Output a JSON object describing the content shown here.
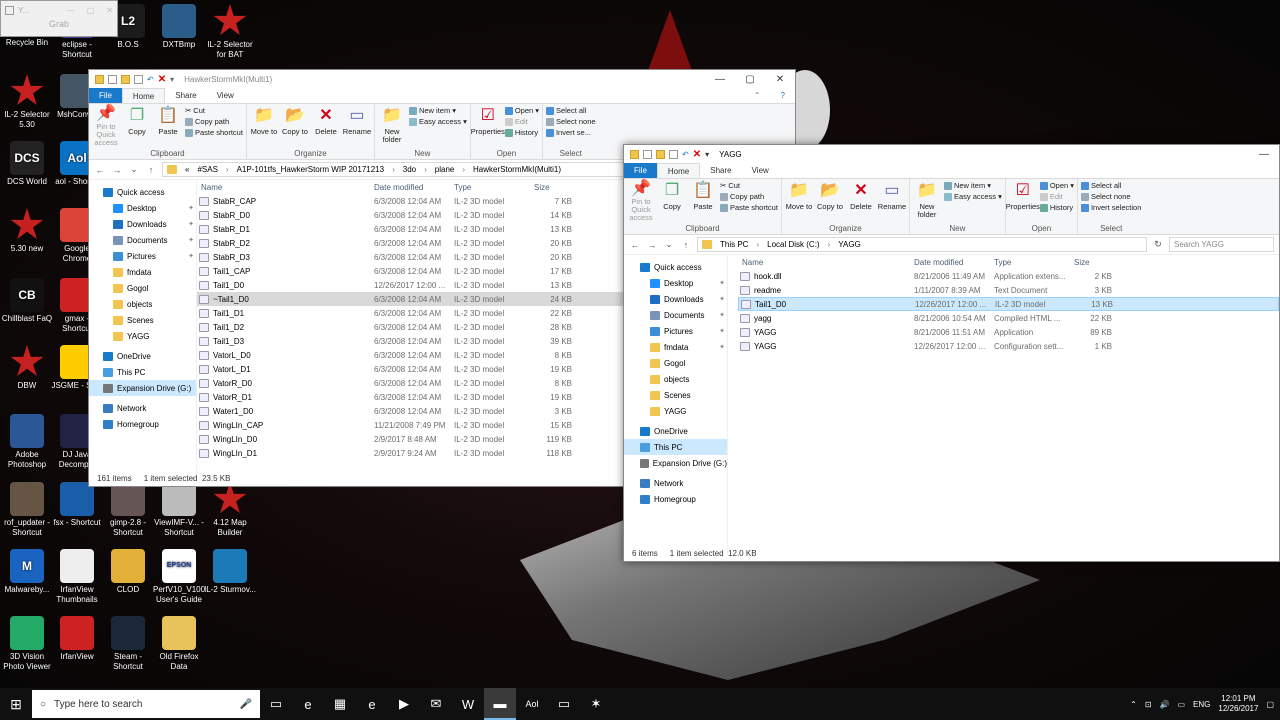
{
  "desktop": {
    "grab_window": {
      "title": "Y...",
      "label": "Grab"
    },
    "icons": [
      {
        "label": "Recycle Bin",
        "icon": "recycle-bin-icon"
      },
      {
        "label": "eclipse - Shortcut",
        "icon": "eclipse-icon"
      },
      {
        "label": "B.O.S",
        "icon": "bos-icon",
        "glyph": "L2"
      },
      {
        "label": "DXTBmp",
        "icon": "plane-icon"
      },
      {
        "label": "IL-2 Selector for BAT",
        "icon": "il2-star-icon"
      },
      {
        "label": "IL-2 Selector 5.30",
        "icon": "il2-star-icon"
      },
      {
        "label": "MshConv...",
        "icon": "document-icon"
      },
      {
        "label": "DCS World",
        "icon": "dcs-icon",
        "glyph": "DCS"
      },
      {
        "label": "aol - Short...",
        "icon": "aol-icon",
        "glyph": "Aol"
      },
      {
        "label": "5.30 new",
        "icon": "il2-star-icon"
      },
      {
        "label": "Google Chrome",
        "icon": "chrome-icon"
      },
      {
        "label": "Chillblast FaQ",
        "icon": "chillblast-icon",
        "glyph": "CB"
      },
      {
        "label": "gmax - Shortcut",
        "icon": "gmax-icon"
      },
      {
        "label": "DBW",
        "icon": "il2-star-icon"
      },
      {
        "label": "JSGME - Sh...",
        "icon": "jsgme-icon"
      },
      {
        "label": "Adobe Photoshop",
        "icon": "photoshop-icon"
      },
      {
        "label": "DJ Java Decomp...",
        "icon": "java-icon"
      },
      {
        "label": "rof_updater - Shortcut",
        "icon": "rof-icon"
      },
      {
        "label": "fsx - Shortcut",
        "icon": "fsx-icon"
      },
      {
        "label": "gimp-2.8 - Shortcut",
        "icon": "gimp-icon"
      },
      {
        "label": "ViewIMF-V... - Shortcut",
        "icon": "document-icon"
      },
      {
        "label": "4.12 Map Builder",
        "icon": "il2-star-icon"
      },
      {
        "label": "Malwareby...",
        "icon": "malwarebytes-icon",
        "glyph": "M"
      },
      {
        "label": "IrfanView Thumbnails",
        "icon": "irfanview-icon"
      },
      {
        "label": "CLOD",
        "icon": "clod-icon"
      },
      {
        "label": "PerfV10_V100 User's Guide",
        "icon": "epson-icon",
        "glyph": "EPSON"
      },
      {
        "label": "IL-2 Sturmov...",
        "icon": "il2-sturmovik-icon"
      },
      {
        "label": "3D Vision Photo Viewer",
        "icon": "3d-vision-icon"
      },
      {
        "label": "IrfanView",
        "icon": "irfanview-icon"
      },
      {
        "label": "Steam - Shortcut",
        "icon": "steam-icon"
      },
      {
        "label": "Old Firefox Data",
        "icon": "folder-icon"
      }
    ]
  },
  "ribbon": {
    "tabs": [
      "File",
      "Home",
      "Share",
      "View"
    ],
    "clipboard": {
      "pin": "Pin to Quick access",
      "copy": "Copy",
      "paste": "Paste",
      "cut": "Cut",
      "copy_path": "Copy path",
      "paste_shortcut": "Paste shortcut",
      "name": "Clipboard"
    },
    "organize": {
      "move_to": "Move to",
      "copy_to": "Copy to",
      "delete": "Delete",
      "rename": "Rename",
      "name": "Organize"
    },
    "new": {
      "new_folder": "New folder",
      "new_item": "New item",
      "easy_access": "Easy access",
      "name": "New"
    },
    "open": {
      "properties": "Properties",
      "open": "Open",
      "edit": "Edit",
      "history": "History",
      "name": "Open"
    },
    "select": {
      "select_all": "Select all",
      "select_none": "Select none",
      "invert": "Invert selection",
      "name": "Select"
    }
  },
  "left_window": {
    "title": "HawkerStormMkI(Multi1)",
    "ribbon_truncated": {
      "invert": "Invert se...",
      "select_name": "Select"
    },
    "path": [
      "«",
      "#SAS",
      "A1P-101tfs_HawkerStorm WIP 20171213",
      "3do",
      "plane",
      "HawkerStormMkI(Multi1)"
    ],
    "nav": [
      {
        "label": "Quick access",
        "icon": "star-icon",
        "color": "#1979ca",
        "pin": false
      },
      {
        "label": "Desktop",
        "icon": "desktop-icon",
        "color": "#1e90ff",
        "pin": true
      },
      {
        "label": "Downloads",
        "icon": "downloads-icon",
        "color": "#1e6fc2",
        "pin": true
      },
      {
        "label": "Documents",
        "icon": "documents-icon",
        "color": "#7a94b8",
        "pin": true
      },
      {
        "label": "Pictures",
        "icon": "pictures-icon",
        "color": "#3b8ed8",
        "pin": true
      },
      {
        "label": "fmdata",
        "icon": "folder-icon",
        "color": "#f1c550",
        "pin": false
      },
      {
        "label": "Gogol",
        "icon": "folder-icon",
        "color": "#f1c550",
        "pin": false
      },
      {
        "label": "objects",
        "icon": "folder-icon",
        "color": "#f1c550",
        "pin": false
      },
      {
        "label": "Scenes",
        "icon": "folder-icon",
        "color": "#f1c550",
        "pin": false
      },
      {
        "label": "YAGG",
        "icon": "folder-icon",
        "color": "#f1c550",
        "pin": false
      },
      {
        "label": "OneDrive",
        "icon": "onedrive-icon",
        "color": "#1979ca",
        "pin": false
      },
      {
        "label": "This PC",
        "icon": "pc-icon",
        "color": "#4a9ee0",
        "pin": false
      },
      {
        "label": "Expansion Drive (G:)",
        "icon": "drive-icon",
        "color": "#777777",
        "pin": false,
        "selected": true
      },
      {
        "label": "Network",
        "icon": "network-icon",
        "color": "#3b7bc2",
        "pin": false
      },
      {
        "label": "Homegroup",
        "icon": "homegroup-icon",
        "color": "#2f7fc8",
        "pin": false
      }
    ],
    "columns": [
      "Name",
      "Date modified",
      "Type",
      "Size"
    ],
    "files": [
      {
        "name": "StabR_CAP",
        "date": "6/3/2008 12:04 AM",
        "type": "IL-2 3D model",
        "size": "7 KB"
      },
      {
        "name": "StabR_D0",
        "date": "6/3/2008 12:04 AM",
        "type": "IL-2 3D model",
        "size": "14 KB"
      },
      {
        "name": "StabR_D1",
        "date": "6/3/2008 12:04 AM",
        "type": "IL-2 3D model",
        "size": "13 KB"
      },
      {
        "name": "StabR_D2",
        "date": "6/3/2008 12:04 AM",
        "type": "IL-2 3D model",
        "size": "20 KB"
      },
      {
        "name": "StabR_D3",
        "date": "6/3/2008 12:04 AM",
        "type": "IL-2 3D model",
        "size": "20 KB"
      },
      {
        "name": "Tail1_CAP",
        "date": "6/3/2008 12:04 AM",
        "type": "IL-2 3D model",
        "size": "17 KB"
      },
      {
        "name": "Tail1_D0",
        "date": "12/26/2017 12:00 ...",
        "type": "IL-2 3D model",
        "size": "13 KB"
      },
      {
        "name": "~Tail1_D0",
        "date": "6/3/2008 12:04 AM",
        "type": "IL-2 3D model",
        "size": "24 KB",
        "highlight": true
      },
      {
        "name": "Tail1_D1",
        "date": "6/3/2008 12:04 AM",
        "type": "IL-2 3D model",
        "size": "22 KB"
      },
      {
        "name": "Tail1_D2",
        "date": "6/3/2008 12:04 AM",
        "type": "IL-2 3D model",
        "size": "28 KB"
      },
      {
        "name": "Tail1_D3",
        "date": "6/3/2008 12:04 AM",
        "type": "IL-2 3D model",
        "size": "39 KB"
      },
      {
        "name": "VatorL_D0",
        "date": "6/3/2008 12:04 AM",
        "type": "IL-2 3D model",
        "size": "8 KB"
      },
      {
        "name": "VatorL_D1",
        "date": "6/3/2008 12:04 AM",
        "type": "IL-2 3D model",
        "size": "19 KB"
      },
      {
        "name": "VatorR_D0",
        "date": "6/3/2008 12:04 AM",
        "type": "IL-2 3D model",
        "size": "8 KB"
      },
      {
        "name": "VatorR_D1",
        "date": "6/3/2008 12:04 AM",
        "type": "IL-2 3D model",
        "size": "19 KB"
      },
      {
        "name": "Water1_D0",
        "date": "6/3/2008 12:04 AM",
        "type": "IL-2 3D model",
        "size": "3 KB"
      },
      {
        "name": "WingLIn_CAP",
        "date": "11/21/2008 7:49 PM",
        "type": "IL-2 3D model",
        "size": "15 KB"
      },
      {
        "name": "WingLIn_D0",
        "date": "2/9/2017 8:48 AM",
        "type": "IL-2 3D model",
        "size": "119 KB"
      },
      {
        "name": "WingLIn_D1",
        "date": "2/9/2017 9:24 AM",
        "type": "IL-2 3D model",
        "size": "118 KB"
      }
    ],
    "status": {
      "items": "161 items",
      "selected": "1 item selected",
      "size": "23.5 KB"
    }
  },
  "right_window": {
    "title": "YAGG",
    "path": [
      "This PC",
      "Local Disk (C:)",
      "YAGG"
    ],
    "search_placeholder": "Search YAGG",
    "nav": [
      {
        "label": "Quick access",
        "icon": "star-icon",
        "color": "#1979ca",
        "pin": false
      },
      {
        "label": "Desktop",
        "icon": "desktop-icon",
        "color": "#1e90ff",
        "pin": true
      },
      {
        "label": "Downloads",
        "icon": "downloads-icon",
        "color": "#1e6fc2",
        "pin": true
      },
      {
        "label": "Documents",
        "icon": "documents-icon",
        "color": "#7a94b8",
        "pin": true
      },
      {
        "label": "Pictures",
        "icon": "pictures-icon",
        "color": "#3b8ed8",
        "pin": true
      },
      {
        "label": "fmdata",
        "icon": "folder-icon",
        "color": "#f1c550",
        "pin": true
      },
      {
        "label": "Gogol",
        "icon": "folder-icon",
        "color": "#f1c550",
        "pin": false
      },
      {
        "label": "objects",
        "icon": "folder-icon",
        "color": "#f1c550",
        "pin": false
      },
      {
        "label": "Scenes",
        "icon": "folder-icon",
        "color": "#f1c550",
        "pin": false
      },
      {
        "label": "YAGG",
        "icon": "folder-icon",
        "color": "#f1c550",
        "pin": false
      },
      {
        "label": "OneDrive",
        "icon": "onedrive-icon",
        "color": "#1979ca",
        "pin": false
      },
      {
        "label": "This PC",
        "icon": "pc-icon",
        "color": "#4a9ee0",
        "pin": false,
        "selected": true
      },
      {
        "label": "Expansion Drive (G:)",
        "icon": "drive-icon",
        "color": "#777777",
        "pin": false
      },
      {
        "label": "Network",
        "icon": "network-icon",
        "color": "#3b7bc2",
        "pin": false
      },
      {
        "label": "Homegroup",
        "icon": "homegroup-icon",
        "color": "#2f7fc8",
        "pin": false
      }
    ],
    "columns": [
      "Name",
      "Date modified",
      "Type",
      "Size"
    ],
    "files": [
      {
        "name": "hook.dll",
        "date": "8/21/2006 11:49 AM",
        "type": "Application extens...",
        "size": "2 KB",
        "icon": "dll-file-icon"
      },
      {
        "name": "readme",
        "date": "1/11/2007 8:39 AM",
        "type": "Text Document",
        "size": "3 KB",
        "icon": "text-file-icon"
      },
      {
        "name": "Tail1_D0",
        "date": "12/26/2017 12:00 ...",
        "type": "IL-2 3D model",
        "size": "13 KB",
        "icon": "model-file-icon",
        "selected": true
      },
      {
        "name": "yagg",
        "date": "8/21/2006 10:54 AM",
        "type": "Compiled HTML ...",
        "size": "22 KB",
        "icon": "chm-file-icon"
      },
      {
        "name": "YAGG",
        "date": "8/21/2006 11:51 AM",
        "type": "Application",
        "size": "89 KB",
        "icon": "app-file-icon"
      },
      {
        "name": "YAGG",
        "date": "12/26/2017 12:00 ...",
        "type": "Configuration sett...",
        "size": "1 KB",
        "icon": "config-file-icon"
      }
    ],
    "status": {
      "items": "6 items",
      "selected": "1 item selected",
      "size": "12.0 KB"
    }
  },
  "taskbar": {
    "search_placeholder": "Type here to search",
    "apps": [
      {
        "icon": "task-view-icon",
        "glyph": "▭"
      },
      {
        "icon": "edge-icon",
        "glyph": "e"
      },
      {
        "icon": "store-icon",
        "glyph": "▦"
      },
      {
        "icon": "ie-icon",
        "glyph": "e"
      },
      {
        "icon": "media-icon",
        "glyph": "▶"
      },
      {
        "icon": "mail-icon",
        "glyph": "✉"
      },
      {
        "icon": "w-app-icon",
        "glyph": "W"
      },
      {
        "icon": "file-explorer-icon",
        "glyph": "▬",
        "active": true
      },
      {
        "icon": "aol-icon",
        "glyph": "Aol"
      },
      {
        "icon": "window-icon",
        "glyph": "▭"
      },
      {
        "icon": "il2-taskbar-icon",
        "glyph": "✶"
      }
    ],
    "lang": "ENG",
    "time": "12:01 PM",
    "date": "12/26/2017"
  },
  "colors": {
    "accent": "#1979ca",
    "selection": "#cce8ff",
    "delete": "#d0021b",
    "folder": "#f1c550"
  }
}
